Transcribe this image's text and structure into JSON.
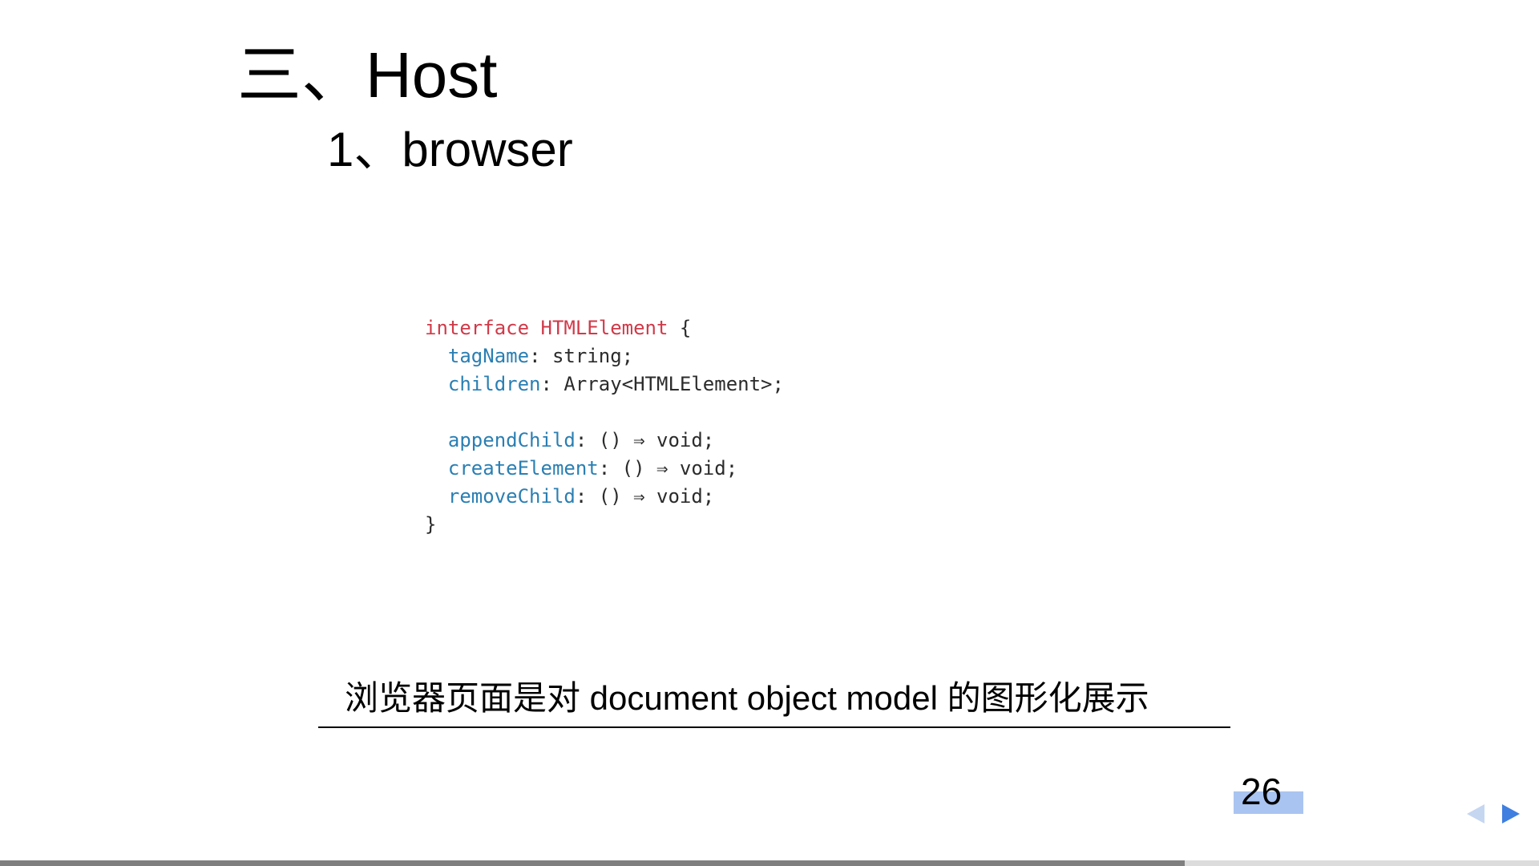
{
  "slide": {
    "title": "三、Host",
    "subtitle": "1、browser",
    "code": {
      "lines": [
        [
          {
            "t": "interface HTMLElement",
            "c": "kw"
          },
          {
            "t": " {",
            "c": "plain"
          }
        ],
        [
          {
            "t": "  ",
            "c": "plain"
          },
          {
            "t": "tagName",
            "c": "prop"
          },
          {
            "t": ": string;",
            "c": "plain"
          }
        ],
        [
          {
            "t": "  ",
            "c": "plain"
          },
          {
            "t": "children",
            "c": "prop"
          },
          {
            "t": ": Array<HTMLElement>;",
            "c": "plain"
          }
        ],
        [
          {
            "t": "",
            "c": "plain"
          }
        ],
        [
          {
            "t": "  ",
            "c": "plain"
          },
          {
            "t": "appendChild",
            "c": "prop"
          },
          {
            "t": ": () ⇒ void;",
            "c": "plain"
          }
        ],
        [
          {
            "t": "  ",
            "c": "plain"
          },
          {
            "t": "createElement",
            "c": "prop"
          },
          {
            "t": ": () ⇒ void;",
            "c": "plain"
          }
        ],
        [
          {
            "t": "  ",
            "c": "plain"
          },
          {
            "t": "removeChild",
            "c": "prop"
          },
          {
            "t": ": () ⇒ void;",
            "c": "plain"
          }
        ],
        [
          {
            "t": "}",
            "c": "plain"
          }
        ]
      ]
    },
    "caption": "浏览器页面是对 document object model 的图形化展示",
    "page_number": "26"
  },
  "navigation": {
    "prev_icon": "triangle-left-icon",
    "next_icon": "triangle-right-icon"
  },
  "progress": {
    "fraction": 0.77
  },
  "colors": {
    "keyword": "#d03a49",
    "property": "#2a7fb3",
    "page_number_highlight": "#a9c4f1",
    "nav_active": "#3e7fe0",
    "nav_inactive": "#c5d6f1",
    "progress_fill": "#7f7f7f"
  }
}
